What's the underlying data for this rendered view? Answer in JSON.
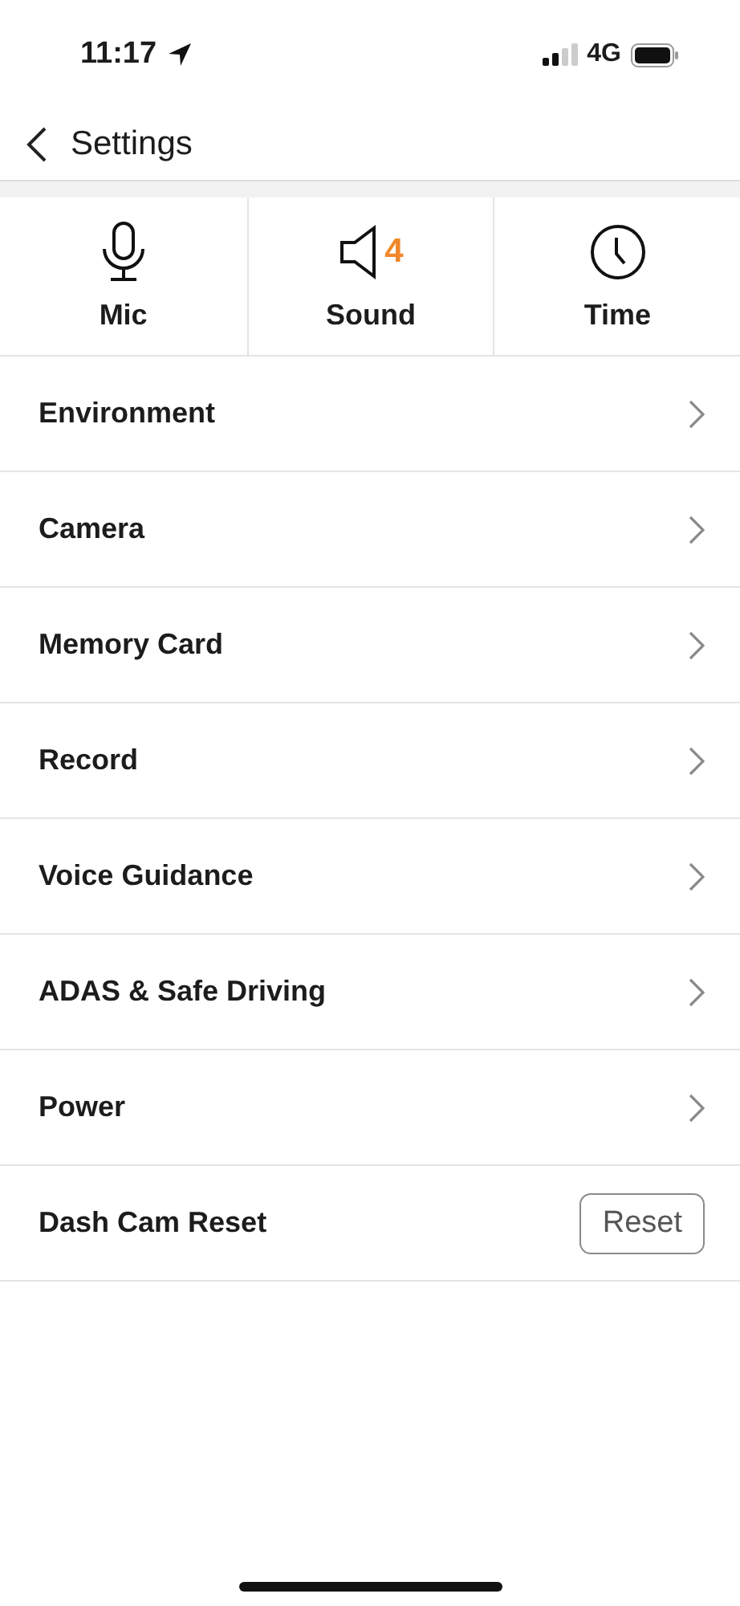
{
  "status_bar": {
    "time": "11:17",
    "network": "4G"
  },
  "nav": {
    "title": "Settings"
  },
  "tiles": [
    {
      "kind": "mic",
      "label": "Mic"
    },
    {
      "kind": "sound",
      "label": "Sound",
      "value": "4"
    },
    {
      "kind": "time",
      "label": "Time"
    }
  ],
  "rows": [
    {
      "kind": "link",
      "label": "Environment"
    },
    {
      "kind": "link",
      "label": "Camera"
    },
    {
      "kind": "link",
      "label": "Memory Card"
    },
    {
      "kind": "link",
      "label": "Record"
    },
    {
      "kind": "link",
      "label": "Voice Guidance"
    },
    {
      "kind": "link",
      "label": "ADAS & Safe Driving"
    },
    {
      "kind": "link",
      "label": "Power"
    },
    {
      "kind": "button",
      "label": "Dash Cam Reset",
      "button": "Reset"
    }
  ]
}
